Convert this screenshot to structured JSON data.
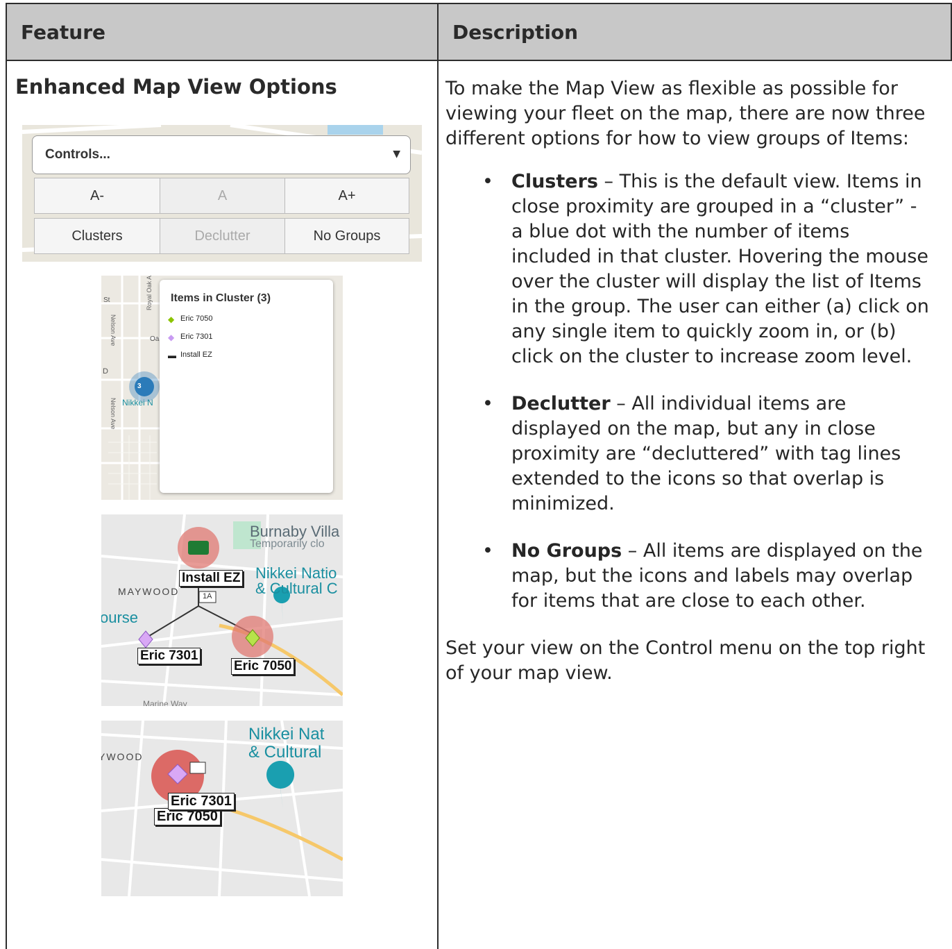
{
  "header": {
    "feature": "Feature",
    "description": "Description"
  },
  "feature": {
    "title": "Enhanced Map View Options",
    "controls": {
      "dropdown": "Controls...",
      "font_buttons": [
        "A-",
        "A",
        "A+"
      ],
      "group_buttons": [
        "Clusters",
        "Declutter",
        "No Groups"
      ]
    },
    "cluster_image": {
      "popup_title": "Items in Cluster (3)",
      "items": [
        "Eric 7050",
        "Eric 7301",
        "Install EZ"
      ],
      "cluster_count": "3",
      "streets": [
        "Nelson Ave",
        "Royal Oak Ave",
        "Nelson Ave",
        "Nikkei N",
        "Oa",
        "D",
        "l St"
      ]
    },
    "declutter_image": {
      "labels": [
        "Install EZ",
        "Eric 7301",
        "Eric 7050"
      ],
      "places": [
        "Burnaby Villa",
        "Temporarily clo",
        "Nikkei Natio",
        "& Cultural C",
        "MAYWOOD",
        "ourse",
        "1A",
        "Marine Way"
      ]
    },
    "nogroups_image": {
      "labels": [
        "Eric 7301",
        "Eric 7050"
      ],
      "places": [
        "Nikkei Nat",
        "& Cultural",
        "YWOOD"
      ]
    }
  },
  "description": {
    "intro": "To make the Map View as flexible as possible for viewing your fleet on the map, there are now three different options for how to view groups of Items:",
    "bullets": [
      {
        "term": "Clusters",
        "text": " – This is the default view. Items in close proximity are grouped in a “cluster” - a blue dot with the number of items included in that cluster. Hovering the mouse over the cluster will display the list of Items in the group. The user can either (a) click on any single item to quickly zoom in, or (b) click on the cluster to increase zoom level."
      },
      {
        "term": "Declutter",
        "text": " – All individual items are displayed on the map, but any in close proximity are “decluttered” with tag lines extended to the icons so that overlap is minimized."
      },
      {
        "term": "No Groups",
        "text": " – All items are displayed on the map, but the icons and labels may overlap for items that are close to each other."
      }
    ],
    "outro": "Set your view on the Control menu on the top right of your map view."
  },
  "colors": {
    "header_bg": "#c8c8c8",
    "cluster_blue": "#2b7bb9",
    "marker_red": "#e07a73",
    "poi_teal": "#1a9fb0"
  }
}
